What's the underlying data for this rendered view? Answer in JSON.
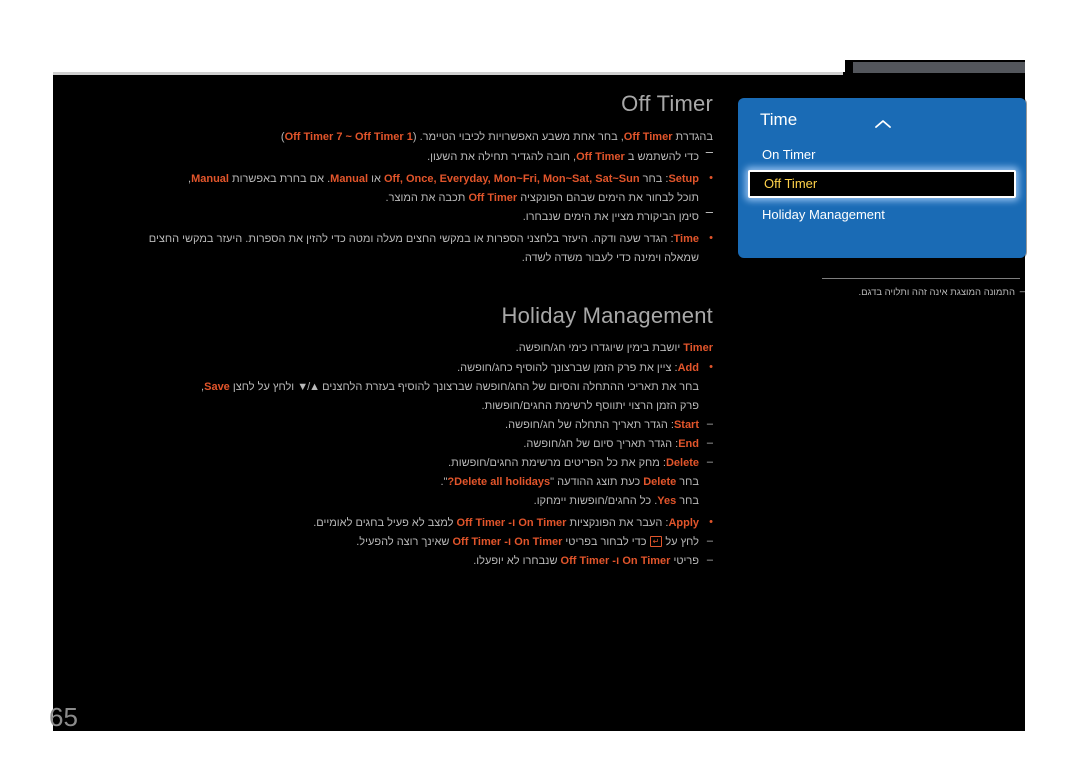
{
  "page": {
    "number": "65"
  },
  "osd": {
    "title": "Time",
    "chevron_icon": "chevron-up-icon",
    "items": [
      {
        "label": "On Timer",
        "selected": false
      },
      {
        "label": "Off Timer",
        "selected": true
      },
      {
        "label": "Holiday Management",
        "selected": false
      }
    ],
    "colors": {
      "panel": "#1a6bb5",
      "selected_text": "#ffd24a",
      "selected_bg": "#000000",
      "glow": "#b4d7ff"
    }
  },
  "caption": {
    "text": "התמונה המוצגת אינה זהה ותלויה בדגם."
  },
  "sections": [
    {
      "id": "off-timer",
      "title": "Off Timer",
      "intro_pre": "בהגדרת ",
      "intro_term": "Off Timer",
      "intro_mid": ", בחר אחת משבע האפשרויות לכיבוי הטיימר. (",
      "intro_term2": "Off Timer 7 ~ Off Timer 1",
      "intro_post": ")",
      "note_pre": "כדי להשתמש ב ",
      "note_term": "Off Timer",
      "note_post": ", חובה להגדיר תחילה את השעון.",
      "bullets": [
        {
          "term": "Setup",
          "line1_a": ": בחר ",
          "line1_terms": "Off, Once, Everyday, Mon~Fri, Mon~Sat, Sat~Sun",
          "line1_b": " או ",
          "line1_term2": "Manual",
          "line1_c": ". אם בחרת באפשרות ",
          "line1_term3": "Manual",
          "line1_d": ",",
          "line2_a": "תוכל לבחור את הימים שבהם הפונקציה ",
          "line2_term": "Off Timer",
          "line2_b": " תכבה את המוצר.",
          "note": "סימן הביקורת מציין את הימים שנבחרו."
        },
        {
          "term": "Time",
          "line1": ": הגדר שעה ודקה. היעזר בלחצני הספרות או במקשי החצים מעלה ומטה כדי להזין את הספרות. היעזר במקשי החצים",
          "line2": "שמאלה וימינה כדי לעבור משדה לשדה."
        }
      ]
    },
    {
      "id": "holiday-management",
      "title": "Holiday Management",
      "intro_term": "Timer",
      "intro_post": " יושבת בימין שיוגדרו כימי חג/חופשה.",
      "bullets": [
        {
          "term": "Add",
          "line1": ": ציין את פרק הזמן שברצונך להוסיף כחג/חופשה.",
          "line2_a": "בחר את תאריכי ההתחלה והסיום של החג/חופשה שברצונך להוסיף בעזרת הלחצנים ",
          "line2_arrows": "▲/▼",
          "line2_b": " ולחץ על לחצן ",
          "line2_term": "Save",
          "line2_c": ",",
          "line3": "פרק הזמן הרצוי יתווסף לרשימת החגים/חופשות.",
          "sub": [
            {
              "term": "Start",
              "text": ": הגדר תאריך התחלה של חג/חופשה."
            },
            {
              "term": "End",
              "text": ": הגדר תאריך סיום של חג/חופשה."
            },
            {
              "term": "Delete",
              "text": ": מחק את כל הפריטים מרשימת החגים/חופשות."
            }
          ],
          "delete_line_a": "בחר ",
          "delete_term": "Delete",
          "delete_line_b": " כעת תוצג ההודעה \"",
          "delete_term2": "Delete all holidays?",
          "delete_line_c": "\".",
          "yes_line_a": "בחר ",
          "yes_term": "Yes",
          "yes_line_b": ". כל החגים/חופשות יימחקו."
        },
        {
          "term": "Apply",
          "line1_a": ": העבר את הפונקציות ",
          "line1_terms": "On Timer ו- Off Timer",
          "line1_b": " למצב לא פעיל בחגים לאומיים.",
          "sub": [
            {
              "pre": "לחץ על ",
              "kbd": "↵",
              "mid": " כדי לבחור בפריטי ",
              "terms": "On Timer ו- Off Timer",
              "post": " שאינך רוצה להפעיל."
            },
            {
              "pre": "פריטי ",
              "terms": "On Timer ו- Off Timer",
              "post": " שנבחרו לא יופעלו."
            }
          ]
        }
      ]
    }
  ]
}
